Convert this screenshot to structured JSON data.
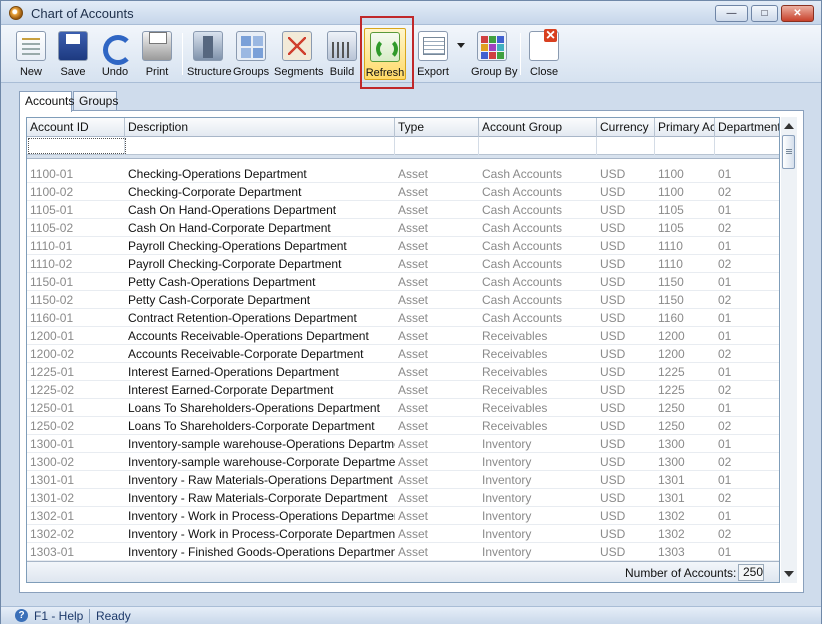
{
  "window": {
    "title": "Chart of Accounts",
    "min_glyph": "—",
    "max_glyph": "□",
    "close_glyph": "✕"
  },
  "toolbar": {
    "new": "New",
    "save": "Save",
    "undo": "Undo",
    "print": "Print",
    "structure": "Structure",
    "groups": "Groups",
    "segments": "Segments",
    "build": "Build",
    "refresh": "Refresh",
    "export": "Export",
    "group_by": "Group By",
    "close": "Close"
  },
  "tabs": {
    "accounts": "Accounts",
    "groups": "Groups"
  },
  "grid": {
    "columns": [
      "Account ID",
      "Description",
      "Type",
      "Account Group",
      "Currency",
      "Primary Acc",
      "Department"
    ],
    "rows": [
      [
        "1100-01",
        "Checking-Operations Department",
        "Asset",
        "Cash Accounts",
        "USD",
        "1100",
        "01"
      ],
      [
        "1100-02",
        "Checking-Corporate Department",
        "Asset",
        "Cash Accounts",
        "USD",
        "1100",
        "02"
      ],
      [
        "1105-01",
        "Cash On Hand-Operations Department",
        "Asset",
        "Cash Accounts",
        "USD",
        "1105",
        "01"
      ],
      [
        "1105-02",
        "Cash On Hand-Corporate Department",
        "Asset",
        "Cash Accounts",
        "USD",
        "1105",
        "02"
      ],
      [
        "1110-01",
        "Payroll Checking-Operations Department",
        "Asset",
        "Cash Accounts",
        "USD",
        "1110",
        "01"
      ],
      [
        "1110-02",
        "Payroll Checking-Corporate Department",
        "Asset",
        "Cash Accounts",
        "USD",
        "1110",
        "02"
      ],
      [
        "1150-01",
        "Petty Cash-Operations Department",
        "Asset",
        "Cash Accounts",
        "USD",
        "1150",
        "01"
      ],
      [
        "1150-02",
        "Petty Cash-Corporate Department",
        "Asset",
        "Cash Accounts",
        "USD",
        "1150",
        "02"
      ],
      [
        "1160-01",
        "Contract Retention-Operations Department",
        "Asset",
        "Cash Accounts",
        "USD",
        "1160",
        "01"
      ],
      [
        "1200-01",
        "Accounts Receivable-Operations Department",
        "Asset",
        "Receivables",
        "USD",
        "1200",
        "01"
      ],
      [
        "1200-02",
        "Accounts Receivable-Corporate Department",
        "Asset",
        "Receivables",
        "USD",
        "1200",
        "02"
      ],
      [
        "1225-01",
        "Interest Earned-Operations Department",
        "Asset",
        "Receivables",
        "USD",
        "1225",
        "01"
      ],
      [
        "1225-02",
        "Interest Earned-Corporate Department",
        "Asset",
        "Receivables",
        "USD",
        "1225",
        "02"
      ],
      [
        "1250-01",
        "Loans To Shareholders-Operations Department",
        "Asset",
        "Receivables",
        "USD",
        "1250",
        "01"
      ],
      [
        "1250-02",
        "Loans To Shareholders-Corporate Department",
        "Asset",
        "Receivables",
        "USD",
        "1250",
        "02"
      ],
      [
        "1300-01",
        "Inventory-sample warehouse-Operations Department",
        "Asset",
        "Inventory",
        "USD",
        "1300",
        "01"
      ],
      [
        "1300-02",
        "Inventory-sample warehouse-Corporate Department",
        "Asset",
        "Inventory",
        "USD",
        "1300",
        "02"
      ],
      [
        "1301-01",
        "Inventory - Raw Materials-Operations Department",
        "Asset",
        "Inventory",
        "USD",
        "1301",
        "01"
      ],
      [
        "1301-02",
        "Inventory - Raw Materials-Corporate Department",
        "Asset",
        "Inventory",
        "USD",
        "1301",
        "02"
      ],
      [
        "1302-01",
        "Inventory - Work in Process-Operations Department",
        "Asset",
        "Inventory",
        "USD",
        "1302",
        "01"
      ],
      [
        "1302-02",
        "Inventory - Work in Process-Corporate Department",
        "Asset",
        "Inventory",
        "USD",
        "1302",
        "02"
      ],
      [
        "1303-01",
        "Inventory - Finished Goods-Operations Department",
        "Asset",
        "Inventory",
        "USD",
        "1303",
        "01"
      ]
    ],
    "count_label": "Number of Accounts:",
    "count_value": "250"
  },
  "status": {
    "help": "F1 - Help",
    "ready": "Ready",
    "help_glyph": "?"
  }
}
